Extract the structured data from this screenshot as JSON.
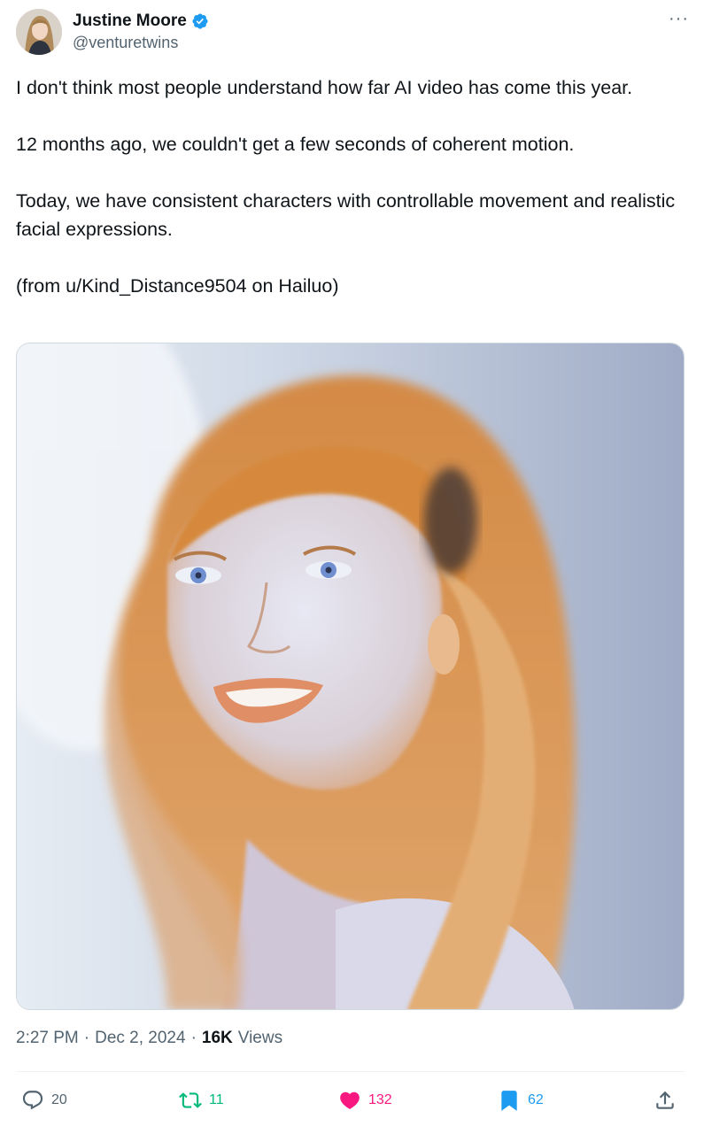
{
  "author": {
    "name": "Justine Moore",
    "handle": "@venturetwins",
    "verified": true,
    "avatar_icon": "avatar-photo"
  },
  "more_icon": "more-horizontal-icon",
  "more_label": "···",
  "tweet": {
    "paragraphs": [
      "I don't think most people understand how far AI video has come this year.",
      "12 months ago, we couldn't get a few seconds of coherent motion.",
      "Today, we have consistent characters with controllable movement and realistic facial expressions.",
      "(from u/Kind_Distance9504 on Hailuo)"
    ]
  },
  "media": {
    "type": "video-thumbnail",
    "description_icon": "portrait-image"
  },
  "meta": {
    "time": "2:27 PM",
    "separator": "·",
    "date": "Dec 2, 2024",
    "views_count": "16K",
    "views_label": "Views"
  },
  "actions": {
    "reply": {
      "count": "20",
      "icon": "reply-icon"
    },
    "retweet": {
      "count": "11",
      "icon": "retweet-icon"
    },
    "like": {
      "count": "132",
      "icon": "heart-icon"
    },
    "bookmark": {
      "count": "62",
      "icon": "bookmark-icon"
    },
    "share": {
      "icon": "share-icon"
    }
  },
  "colors": {
    "verified_blue": "#1d9bf0",
    "retweet_green": "#00ba7c",
    "like_pink": "#f91880",
    "bookmark_blue": "#1d9bf0",
    "secondary_text": "#536471"
  }
}
